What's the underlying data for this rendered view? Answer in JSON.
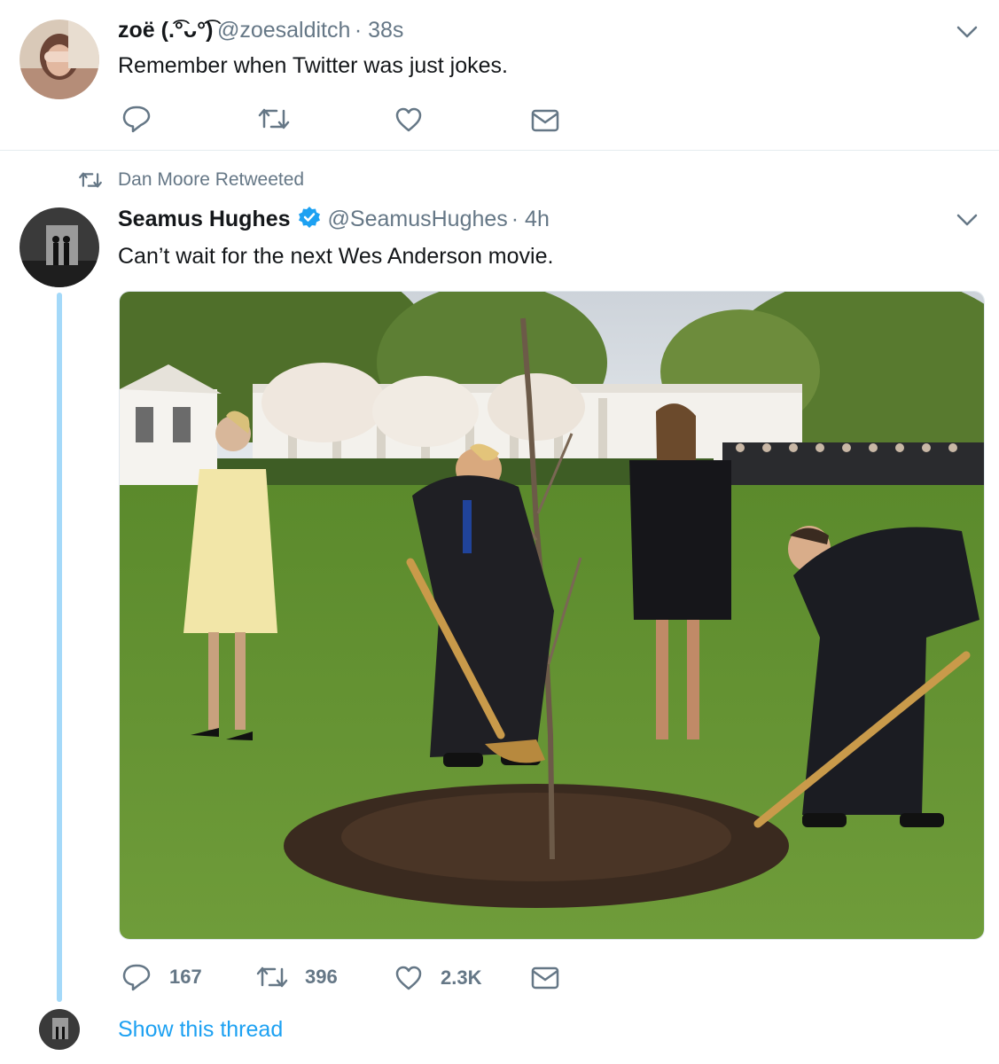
{
  "colors": {
    "accent": "#1da1f2",
    "muted": "#657786",
    "text": "#14171a",
    "divider": "#e6ecf0",
    "thread_line": "#a4d9f9"
  },
  "tweet1": {
    "name": "zoë (.͡°ᴗ°͡)",
    "handle": "@zoesalditch",
    "time": "· 38s",
    "text": "Remember when Twitter was just jokes.",
    "icons": [
      "reply-icon",
      "retweet-icon",
      "like-icon",
      "dm-icon"
    ]
  },
  "retweet_context": {
    "label": "Dan Moore Retweeted",
    "icon": "retweet-icon"
  },
  "tweet2": {
    "name": "Seamus Hughes",
    "verified_icon": "verified-badge-icon",
    "handle": "@SeamusHughes",
    "time": "· 4h",
    "text": "Can’t wait for the next Wes Anderson movie.",
    "media_alt": "photo",
    "counts": {
      "replies": "167",
      "retweets": "396",
      "likes": "2.3K"
    }
  },
  "thread": {
    "show_label": "Show this thread"
  }
}
